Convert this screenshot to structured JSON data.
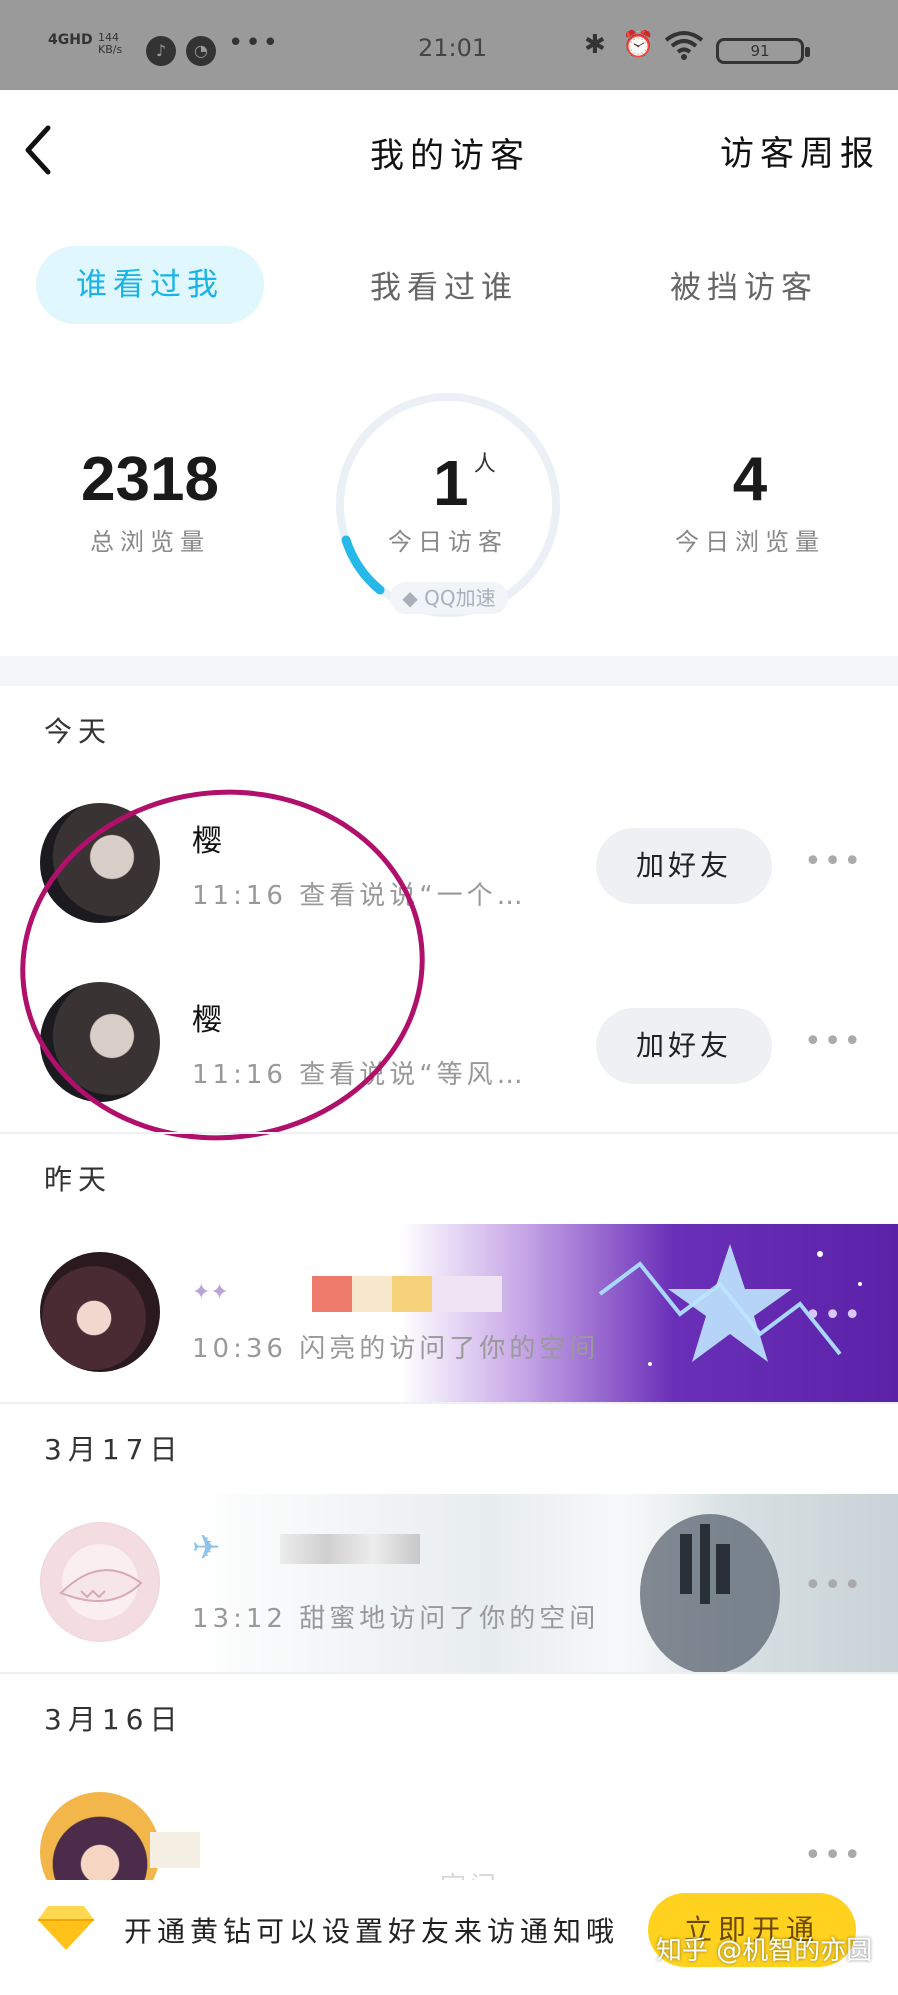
{
  "status_bar": {
    "network": "4GHD",
    "speed_value": "144",
    "speed_unit": "KB/s",
    "time": "21:01",
    "battery": "91"
  },
  "header": {
    "back_icon": "chevron-left-icon",
    "title": "我的访客",
    "weekly_report": "访客周报"
  },
  "tabs": [
    {
      "label": "谁看过我",
      "active": true
    },
    {
      "label": "我看过谁",
      "active": false
    },
    {
      "label": "被挡访客",
      "active": false
    }
  ],
  "stats": {
    "total_views": {
      "value": "2318",
      "label": "总浏览量"
    },
    "today_visitors": {
      "value": "1",
      "unit": "人",
      "label": "今日访客",
      "badge": "QQ加速"
    },
    "today_views": {
      "value": "4",
      "label": "今日浏览量"
    }
  },
  "sections": [
    {
      "title": "今天",
      "visitors": [
        {
          "name": "樱",
          "detail": "11:16 查看说说“一个…",
          "action": "加好友"
        },
        {
          "name": "樱",
          "detail": "11:16 查看说说“等风…",
          "action": "加好友"
        }
      ]
    },
    {
      "title": "昨天",
      "visitors": [
        {
          "name": "",
          "detail": "10:36 闪亮的访问了你的空间"
        }
      ]
    },
    {
      "title": "3月17日",
      "visitors": [
        {
          "name": "",
          "detail": "13:12 甜蜜地访问了你的空间"
        }
      ]
    },
    {
      "title": "3月16日",
      "visitors": [
        {
          "name": "",
          "detail": "空间"
        }
      ]
    }
  ],
  "promo": {
    "text": "开通黄钻可以设置好友来访通知哦",
    "button": "立即开通",
    "icon": "diamond-icon"
  },
  "watermark": "知乎 @机智的亦圆",
  "colors": {
    "accent": "#18b4e6",
    "tab_active_bg": "#dff7fd",
    "highlight_circle": "#b00f6a",
    "promo_button": "#ffd21f"
  }
}
